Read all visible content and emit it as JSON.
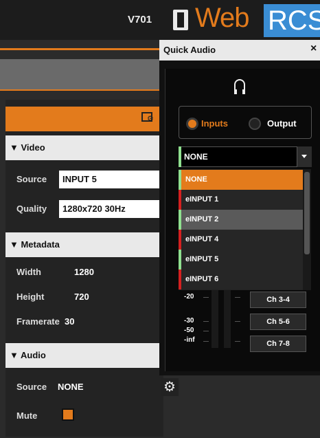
{
  "header": {
    "device": "V701",
    "logo_web": "Web",
    "logo_rcs": "RCS"
  },
  "panel": {
    "video": {
      "title": "▼ Video",
      "source_label": "Source",
      "source_value": "INPUT 5",
      "quality_label": "Quality",
      "quality_value": "1280x720 30Hz"
    },
    "metadata": {
      "title": "▼ Metadata",
      "width_label": "Width",
      "width_value": "1280",
      "height_label": "Height",
      "height_value": "720",
      "framerate_label": "Framerate",
      "framerate_value": "30"
    },
    "audio": {
      "title": "▼ Audio",
      "source_label": "Source",
      "source_value": "NONE",
      "mute_label": "Mute",
      "mute_checked": true
    }
  },
  "quick_audio": {
    "title": "Quick Audio",
    "close": "×",
    "icon": "headphones-icon",
    "mode_inputs": "Inputs",
    "mode_output": "Output",
    "selected_mode": "Inputs",
    "select_value": "NONE",
    "options": [
      {
        "label": "NONE",
        "marker": "#8fe08f",
        "selected": true
      },
      {
        "label": "eINPUT 1",
        "marker": "#d42020",
        "selected": false
      },
      {
        "label": "eINPUT 2",
        "marker": "#8fe08f",
        "selected": false
      },
      {
        "label": "eINPUT 4",
        "marker": "#d42020",
        "selected": false
      },
      {
        "label": "eINPUT 5",
        "marker": "#8fe08f",
        "selected": false
      },
      {
        "label": "eINPUT 6",
        "marker": "#d42020",
        "selected": false
      }
    ],
    "db_labels": [
      "-20",
      "-30",
      "-50",
      "-inf"
    ],
    "channels": [
      "Ch 3-4",
      "Ch 5-6",
      "Ch 7-8"
    ]
  },
  "colors": {
    "accent": "#e37b1c",
    "logo_blue": "#3a8dd4",
    "selected_option_bg": "#e37b1c",
    "hover_option_bg": "#5a5a5a"
  }
}
